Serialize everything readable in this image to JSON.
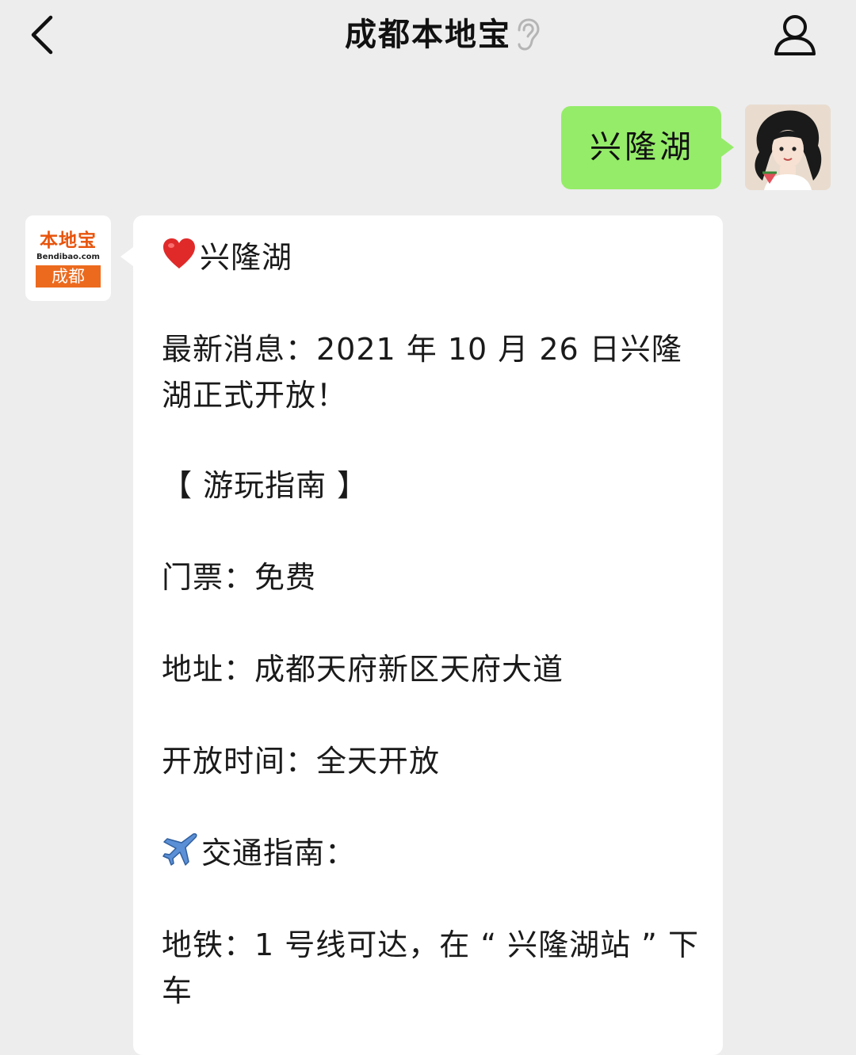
{
  "header": {
    "title": "成都本地宝",
    "back_icon": "chevron-left-icon",
    "mute_icon": "ear-icon",
    "profile_icon": "person-icon"
  },
  "chat": {
    "outgoing": {
      "text": "兴隆湖",
      "bubble_color": "#95ec69"
    },
    "incoming": {
      "avatar": {
        "logo_text": "本地宝",
        "logo_url": "Bendibao.com",
        "logo_city": "成都",
        "brand_color": "#e8540c"
      },
      "lines": [
        "兴隆湖",
        "最新消息：2021 年 10 月 26 日兴隆湖正式开放！",
        "【 游玩指南 】",
        "门票：免费",
        "地址：成都天府新区天府大道",
        "开放时间：全天开放",
        "交通指南：",
        "地铁：1 号线可达，在 “ 兴隆湖站 ” 下车"
      ]
    }
  }
}
